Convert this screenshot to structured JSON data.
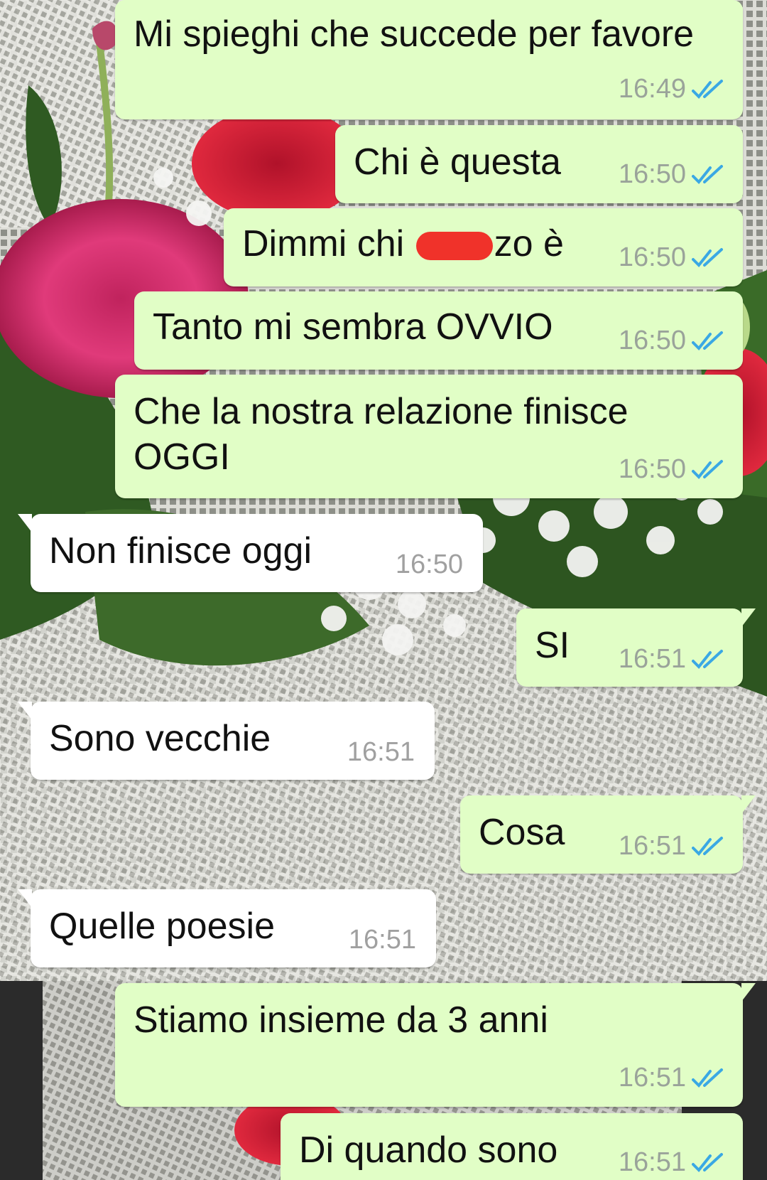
{
  "conversation": {
    "messages": [
      {
        "direction": "outgoing",
        "text": "Mi spieghi che succede per favore",
        "time": "16:49",
        "status": "read"
      },
      {
        "direction": "outgoing",
        "text": "Chi è questa",
        "time": "16:50",
        "status": "read"
      },
      {
        "direction": "outgoing",
        "text_before": "Dimmi chi ",
        "text_after": "zo è",
        "time": "16:50",
        "status": "read"
      },
      {
        "direction": "outgoing",
        "text": "Tanto mi sembra OVVIO",
        "time": "16:50",
        "status": "read"
      },
      {
        "direction": "outgoing",
        "text_line1": "Che la nostra relazione finisce",
        "text_line2": "OGGI",
        "time": "16:50",
        "status": "read"
      },
      {
        "direction": "incoming",
        "text": "Non finisce oggi",
        "time": "16:50"
      },
      {
        "direction": "outgoing",
        "text": "SI",
        "time": "16:51",
        "status": "read"
      },
      {
        "direction": "incoming",
        "text": "Sono vecchie",
        "time": "16:51"
      },
      {
        "direction": "outgoing",
        "text": "Cosa",
        "time": "16:51",
        "status": "read"
      },
      {
        "direction": "incoming",
        "text": "Quelle poesie",
        "time": "16:51"
      },
      {
        "direction": "outgoing",
        "text": "Stiamo insieme da 3 anni",
        "time": "16:51",
        "status": "read"
      },
      {
        "direction": "outgoing",
        "text": "Di quando sono",
        "time": "16:51",
        "status": "read"
      }
    ]
  },
  "icons": {
    "read_receipt": "double-check-icon",
    "redaction": "redaction-mark"
  },
  "colors": {
    "outgoing_bubble": "#e1fec6",
    "incoming_bubble": "#ffffff",
    "read_tick": "#3aa8e4",
    "timestamp": "#9aa39a",
    "redaction": "#f0322a"
  }
}
